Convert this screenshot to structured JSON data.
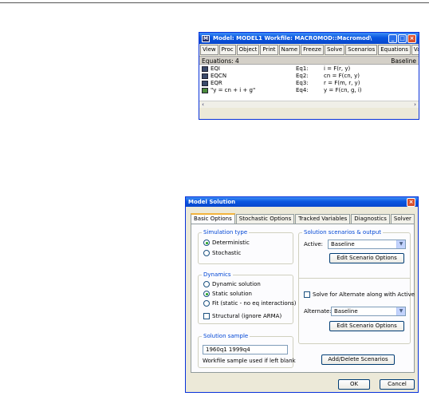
{
  "model_window": {
    "title": "Model: MODEL1   Workfile: MACROMOD::Macromod\\",
    "toolbar": [
      "View",
      "Proc",
      "Object",
      "Print",
      "Name",
      "Freeze",
      "Solve",
      "Scenarios",
      "Equations",
      "Variables"
    ],
    "equations_count": "Equations: 4",
    "scenario": "Baseline",
    "equations": [
      {
        "name": "EQI",
        "id": "Eq1:",
        "spec": "i = F(r, y)"
      },
      {
        "name": "EQCN",
        "id": "Eq2:",
        "spec": "cn = F(cn, y)"
      },
      {
        "name": "EQR",
        "id": "Eq3:",
        "spec": "r = F(m, r, y)"
      },
      {
        "name": "\"y = cn + i + g\"",
        "id": "Eq4:",
        "spec": "y = F(cn, g, i)"
      }
    ]
  },
  "dialog": {
    "title": "Model Solution",
    "tabs": [
      "Basic Options",
      "Stochastic Options",
      "Tracked Variables",
      "Diagnostics",
      "Solver"
    ],
    "simulation_type": {
      "legend": "Simulation type",
      "options": [
        "Deterministic",
        "Stochastic"
      ],
      "selected": "Deterministic"
    },
    "dynamics": {
      "legend": "Dynamics",
      "options": [
        "Dynamic solution",
        "Static solution",
        "Fit (static - no eq interactions)"
      ],
      "selected": "Static solution",
      "structural_label": "Structural (ignore ARMA)"
    },
    "solution_sample": {
      "legend": "Solution sample",
      "value": "1960q1 1999q4",
      "note": "Workfile sample used if left blank"
    },
    "scenarios": {
      "legend": "Solution scenarios & output",
      "active_label": "Active:",
      "active_value": "Baseline",
      "edit_label": "Edit Scenario Options",
      "solve_alternate_label": "Solve for Alternate along with Active",
      "alternate_label": "Alternate:",
      "alternate_value": "Baseline",
      "edit_label_2": "Edit Scenario Options"
    },
    "add_delete_label": "Add/Delete Scenarios",
    "ok_label": "OK",
    "cancel_label": "Cancel"
  }
}
